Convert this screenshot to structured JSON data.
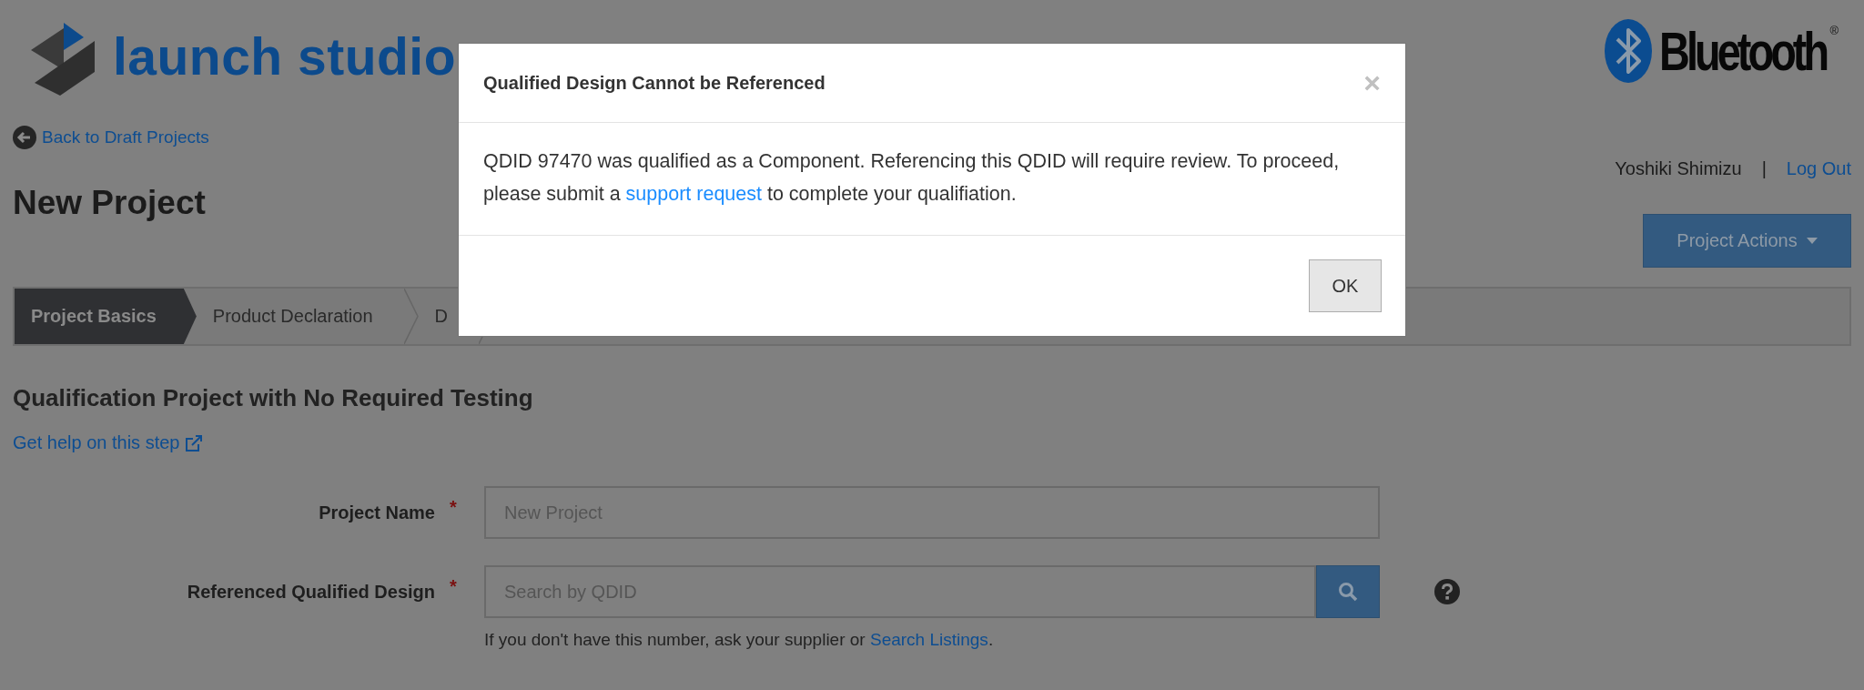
{
  "header": {
    "logo_text": "launch studio",
    "brand_text": "Bluetooth",
    "brand_mark": "®"
  },
  "back_link": "Back to Draft Projects",
  "page_title": "New Project",
  "user": {
    "name": "Yoshiki Shimizu",
    "separator": "|",
    "logout": "Log Out"
  },
  "actions_button": "Project Actions",
  "steps": [
    {
      "label": "Project Basics",
      "selected": true
    },
    {
      "label": "Product Declaration",
      "selected": false
    },
    {
      "label": "D",
      "selected": false
    }
  ],
  "section_title": "Qualification Project with No Required Testing",
  "help_link": "Get help on this step",
  "form": {
    "fields": [
      {
        "label": "Project Name",
        "required": "*",
        "placeholder": "New Project",
        "kind": "text"
      },
      {
        "label": "Referenced Qualified Design",
        "required": "*",
        "placeholder": "Search by QDID",
        "kind": "search"
      }
    ],
    "hint": {
      "text": "If you don't have this number, ask your supplier or",
      "link": "Search Listings",
      "end": "."
    }
  },
  "dialog": {
    "title": "Qualified Design Cannot be Referenced",
    "close": "×",
    "body_before": "QDID 97470 was qualified as a Component. Referencing this QDID will require review. To proceed, please submit a",
    "body_link": "support request",
    "body_after": "to complete your qualifiation.",
    "ok": "OK"
  }
}
